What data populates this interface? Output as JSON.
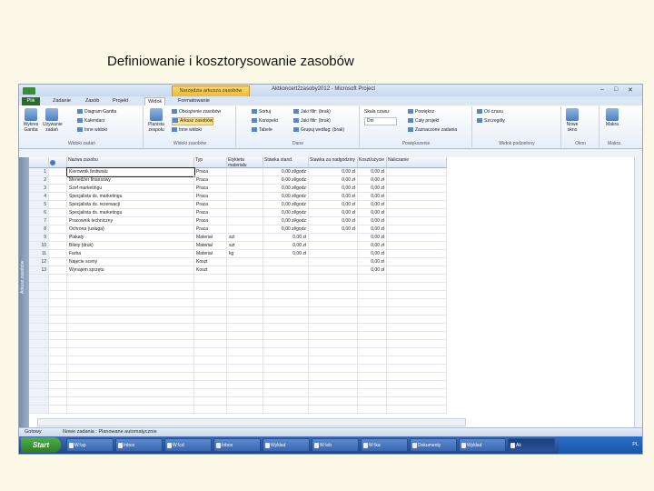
{
  "slide": {
    "title": "Definiowanie i kosztorysowanie zasobów"
  },
  "window": {
    "title": "Aktkoncert2zasoby2012 - Microsoft Project",
    "context_tab": "Narzędzia arkusza zasobów",
    "controls": [
      "–",
      "□",
      "✕"
    ]
  },
  "tabs": [
    {
      "label": "Plik"
    },
    {
      "label": "Zadanie"
    },
    {
      "label": "Zasób"
    },
    {
      "label": "Projekt"
    },
    {
      "label": "Widok"
    },
    {
      "label": "Formatowanie"
    }
  ],
  "ribbon": {
    "groups": [
      {
        "label": "Widoki zadań",
        "items": [
          "Diagram Gantta",
          "Kalendarz",
          "Inne widoki"
        ],
        "big": [
          "Wykres Gantta",
          "Używanie zadań"
        ]
      },
      {
        "label": "Widoki zasobów",
        "items": [
          "Obciążenie zasobów",
          "Arkusz zasobów",
          "Inne widoki"
        ],
        "big": [
          "Planista zespołu"
        ]
      },
      {
        "label": "Dane",
        "items": [
          "Sortuj",
          "Konspekt",
          "Tabele",
          "Jaki filtr: (brak)",
          "Jaki filtr: (brak)",
          "Grupuj według: (brak)"
        ]
      },
      {
        "label": "Powiększenie",
        "items": [
          "Skala czasu:",
          "Dni",
          "Powiększ",
          "Cały projekt",
          "Zaznaczone zadania"
        ]
      },
      {
        "label": "Widok podzielony",
        "items": [
          "Oś czasu",
          "Szczegóły"
        ]
      },
      {
        "label": "Okno",
        "items": [
          "Nowe okno"
        ]
      },
      {
        "label": "Makra",
        "items": [
          "Makra"
        ]
      }
    ]
  },
  "table": {
    "columns": [
      "",
      "Nazwa zasobu",
      "Typ",
      "Etykieta materiału",
      "Stawka stand.",
      "Stawka za nadgodziny",
      "Koszt/użycie",
      "Naliczanie"
    ],
    "rows": [
      {
        "id": "1",
        "name": "Kierownik festiwalu",
        "type": "Praca",
        "material": "",
        "std": "0,00 zł/godz",
        "ovt": "0,00 zł",
        "cost": "0,00 zł",
        "acc": ""
      },
      {
        "id": "2",
        "name": "Menedżer finansowy",
        "type": "Praca",
        "material": "",
        "std": "0,00 zł/godz",
        "ovt": "0,00 zł",
        "cost": "0,00 zł",
        "acc": ""
      },
      {
        "id": "3",
        "name": "Szef marketingu",
        "type": "Praca",
        "material": "",
        "std": "0,00 zł/godz",
        "ovt": "0,00 zł",
        "cost": "0,00 zł",
        "acc": ""
      },
      {
        "id": "4",
        "name": "Specjalista ds. marketingu",
        "type": "Praca",
        "material": "",
        "std": "0,00 zł/godz",
        "ovt": "0,00 zł",
        "cost": "0,00 zł",
        "acc": ""
      },
      {
        "id": "5",
        "name": "Specjalista ds. rezerwacji",
        "type": "Praca",
        "material": "",
        "std": "0,00 zł/godz",
        "ovt": "0,00 zł",
        "cost": "0,00 zł",
        "acc": ""
      },
      {
        "id": "6",
        "name": "Specjalista ds. marketingu",
        "type": "Praca",
        "material": "",
        "std": "0,00 zł/godz",
        "ovt": "0,00 zł",
        "cost": "0,00 zł",
        "acc": ""
      },
      {
        "id": "7",
        "name": "Pracownik techniczny",
        "type": "Praca",
        "material": "",
        "std": "0,00 zł/godz",
        "ovt": "0,00 zł",
        "cost": "0,00 zł",
        "acc": ""
      },
      {
        "id": "8",
        "name": "Ochrona (usługa)",
        "type": "Praca",
        "material": "",
        "std": "0,00 zł/godz",
        "ovt": "0,00 zł",
        "cost": "0,00 zł",
        "acc": ""
      },
      {
        "id": "9",
        "name": "Plakaty",
        "type": "Materiał",
        "material": "szt",
        "std": "0,00 zł",
        "ovt": "",
        "cost": "0,00 zł",
        "acc": ""
      },
      {
        "id": "10",
        "name": "Bilety (druk)",
        "type": "Materiał",
        "material": "szt",
        "std": "0,00 zł",
        "ovt": "",
        "cost": "0,00 zł",
        "acc": ""
      },
      {
        "id": "11",
        "name": "Farba",
        "type": "Materiał",
        "material": "kg",
        "std": "0,00 zł",
        "ovt": "",
        "cost": "0,00 zł",
        "acc": ""
      },
      {
        "id": "12",
        "name": "Najęcie sceny",
        "type": "Koszt",
        "material": "",
        "std": "",
        "ovt": "",
        "cost": "0,00 zł",
        "acc": ""
      },
      {
        "id": "13",
        "name": "Wynajem sprzętu",
        "type": "Koszt",
        "material": "",
        "std": "",
        "ovt": "",
        "cost": "0,00 zł",
        "acc": ""
      }
    ]
  },
  "sidebar_label": "Arkusz zasobów",
  "status": {
    "left": "Gotowy",
    "mode": "Nowe zadania : Planowane automatycznie"
  },
  "taskbar": {
    "start": "Start",
    "buttons": [
      "W:\\sp",
      "Inbox",
      "W:\\cd",
      "Inbox",
      "Wykład",
      "W:\\eb",
      "W:\\ka",
      "Dokumenty",
      "Wykład",
      "Ak"
    ],
    "tray": "PL"
  }
}
